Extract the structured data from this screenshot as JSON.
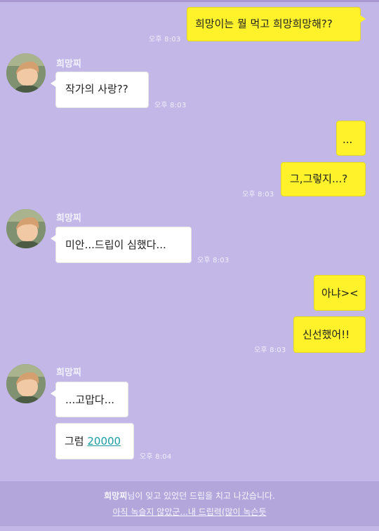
{
  "contact_name": "희망찌",
  "messages": [
    {
      "from": "me",
      "text": "희망이는 뭘 먹고 희망희망해??",
      "time": "오후 8:03"
    },
    {
      "from": "other",
      "text": "작가의 사랑??",
      "time": "오후 8:03"
    },
    {
      "from": "me",
      "text": "...",
      "time": ""
    },
    {
      "from": "me",
      "text": "그,그렇지...?",
      "time": "오후 8:03"
    },
    {
      "from": "other",
      "text": "미안...드립이 심했다...",
      "time": "오후 8:03"
    },
    {
      "from": "me",
      "text": "아냐><",
      "time": ""
    },
    {
      "from": "me",
      "text": "신선했어!!",
      "time": "오후 8:03"
    },
    {
      "from": "other",
      "text": "...고맙다...",
      "time": ""
    },
    {
      "from": "other",
      "text_prefix": "그럼 ",
      "link_text": "20000",
      "time": "오후 8:04"
    }
  ],
  "notice": {
    "name": "희망찌",
    "line1_rest": "님이 잊고 있었던 드립을 치고 나갔습니다.",
    "line2": "아직 녹슬지 않았군...내 드립력(많이 녹슨듯"
  },
  "colors": {
    "background": "#c2b7e6",
    "my_bubble": "#fff22a",
    "their_bubble": "#ffffff",
    "link": "#1a9ca0"
  }
}
